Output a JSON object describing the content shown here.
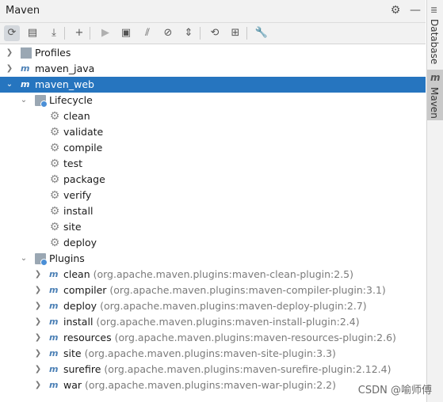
{
  "window": {
    "title": "Maven"
  },
  "titlebar": {
    "settings_icon": "gear-icon",
    "hide_icon": "minus-icon"
  },
  "toolbar": {
    "buttons": [
      {
        "name": "reload-all-projects-button",
        "icon": "refresh-icon",
        "glyph": "⟳"
      },
      {
        "name": "generate-sources-button",
        "icon": "folder-refresh-icon",
        "glyph": "▤"
      },
      {
        "name": "download-sources-button",
        "icon": "download-icon",
        "glyph": "⤓"
      },
      {
        "name": "add-maven-project-button",
        "icon": "plus-icon",
        "glyph": "+"
      },
      {
        "name": "run-maven-build-button",
        "icon": "play-icon",
        "glyph": "▶"
      },
      {
        "name": "execute-maven-goal-button",
        "icon": "terminal-icon",
        "glyph": "▣"
      },
      {
        "name": "toggle-offline-mode-button",
        "icon": "offline-icon",
        "glyph": "⫽"
      },
      {
        "name": "skip-tests-button",
        "icon": "skip-tests-icon",
        "glyph": "⊘"
      },
      {
        "name": "show-dependencies-button",
        "icon": "collapse-icon",
        "glyph": "⇕"
      },
      {
        "name": "analyze-dependencies-button",
        "icon": "analyze-icon",
        "glyph": "⟲"
      },
      {
        "name": "show-diagram-button",
        "icon": "diagram-icon",
        "glyph": "⊞"
      },
      {
        "name": "maven-settings-button",
        "icon": "wrench-icon",
        "glyph": "🔧"
      }
    ]
  },
  "tree": {
    "profiles": "Profiles",
    "maven_java": "maven_java",
    "maven_web": "maven_web",
    "lifecycle": "Lifecycle",
    "lifecycle_items": [
      "clean",
      "validate",
      "compile",
      "test",
      "package",
      "verify",
      "install",
      "site",
      "deploy"
    ],
    "plugins": "Plugins",
    "plugin_items": [
      {
        "name": "clean",
        "coord": "(org.apache.maven.plugins:maven-clean-plugin:2.5)"
      },
      {
        "name": "compiler",
        "coord": "(org.apache.maven.plugins:maven-compiler-plugin:3.1)"
      },
      {
        "name": "deploy",
        "coord": "(org.apache.maven.plugins:maven-deploy-plugin:2.7)"
      },
      {
        "name": "install",
        "coord": "(org.apache.maven.plugins:maven-install-plugin:2.4)"
      },
      {
        "name": "resources",
        "coord": "(org.apache.maven.plugins:maven-resources-plugin:2.6)"
      },
      {
        "name": "site",
        "coord": "(org.apache.maven.plugins:maven-site-plugin:3.3)"
      },
      {
        "name": "surefire",
        "coord": "(org.apache.maven.plugins:maven-surefire-plugin:2.12.4)"
      },
      {
        "name": "war",
        "coord": "(org.apache.maven.plugins:maven-war-plugin:2.2)"
      }
    ]
  },
  "sidebar": {
    "database": "Database",
    "maven_glyph": "m",
    "maven": "Maven"
  },
  "watermark": "CSDN @喻师傅",
  "colors": {
    "selection": "#2675bf",
    "icon_blue": "#4a7fb5"
  }
}
